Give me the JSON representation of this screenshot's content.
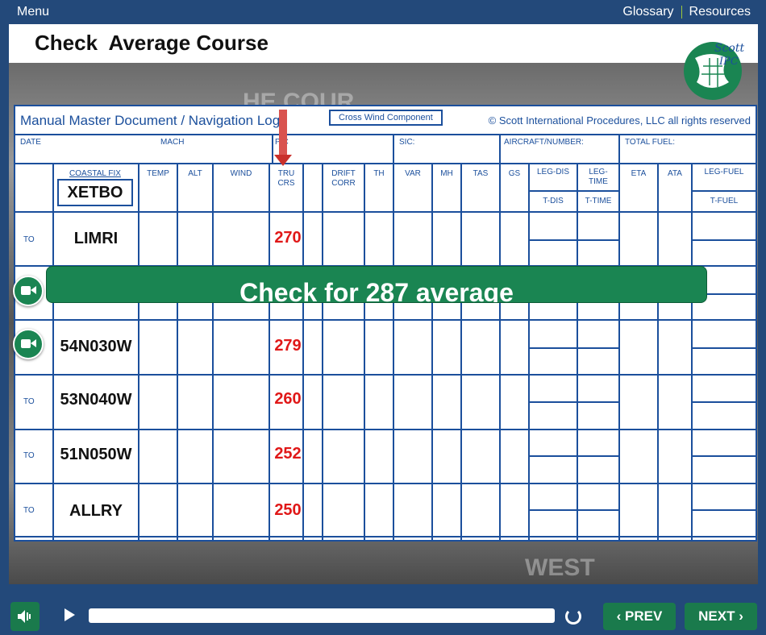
{
  "topbar": {
    "menu": "Menu",
    "glossary": "Glossary",
    "resources": "Resources"
  },
  "slide": {
    "title": "Check  Average Course"
  },
  "logo": {
    "line1": "Scott",
    "line2": "IPC"
  },
  "watermarks": {
    "top": "HE COUR",
    "bottom": "WEST"
  },
  "document": {
    "title": "Manual Master Document / Navigation Log",
    "cross_wind": "Cross Wind Component",
    "copyright": "© Scott International Procedures, LLC all rights reserved",
    "row2": {
      "date": "DATE",
      "mach": "MACH",
      "pic": "PIC",
      "sic": "SIC:",
      "aircraft": "AIRCRAFT/NUMBER:",
      "fuel": "TOTAL FUEL:"
    },
    "columns": {
      "coastal_fix": "COASTAL FIX",
      "temp": "TEMP",
      "alt": "ALT",
      "wind": "WIND",
      "tru1": "TRU",
      "tru2": "CRS",
      "drift1": "DRIFT",
      "drift2": "CORR",
      "th": "TH",
      "var": "VAR",
      "mh": "MH",
      "tas": "TAS",
      "gs": "GS",
      "legdis": "LEG-DIS",
      "tdis": "T-DIS",
      "legtime1": "LEG-",
      "legtime2": "TIME",
      "ttime": "T-TIME",
      "eta": "ETA",
      "ata": "ATA",
      "legfuel": "LEG-FUEL",
      "tfuel": "T-FUEL"
    },
    "start_fix": "XETBO",
    "rows": [
      {
        "to": "TO",
        "fix": "LIMRI",
        "crs": "270"
      },
      {
        "to": "",
        "fix": "54N030W",
        "crs": "279"
      },
      {
        "to": "TO",
        "fix": "53N040W",
        "crs": "260"
      },
      {
        "to": "TO",
        "fix": "51N050W",
        "crs": "252"
      },
      {
        "to": "TO",
        "fix": "ALLRY",
        "crs": "250"
      }
    ]
  },
  "banner": {
    "text": "Check for 287 average"
  },
  "controls": {
    "prev": "PREV",
    "next": "NEXT",
    "progress": 0
  }
}
